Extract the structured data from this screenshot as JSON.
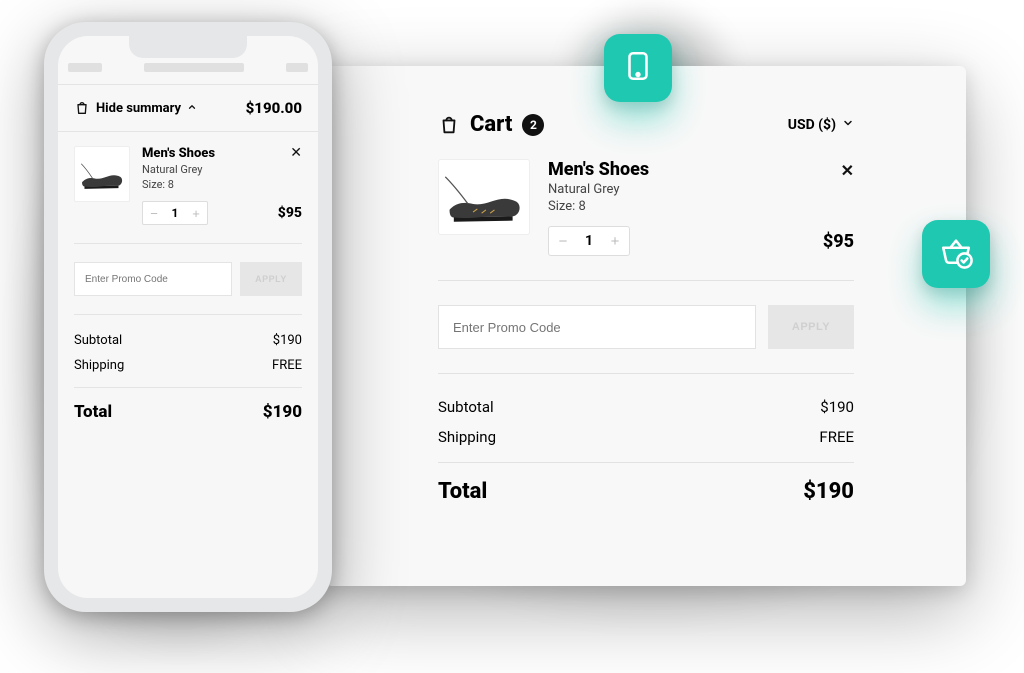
{
  "mobile": {
    "summary_toggle_label": "Hide summary",
    "summary_price": "$190.00",
    "item": {
      "title": "Men's Shoes",
      "color": "Natural Grey",
      "size_label": "Size: 8",
      "qty": "1",
      "price": "$95"
    },
    "promo_placeholder": "Enter Promo Code",
    "apply_label": "APPLY",
    "subtotal_label": "Subtotal",
    "subtotal_value": "$190",
    "shipping_label": "Shipping",
    "shipping_value": "FREE",
    "total_label": "Total",
    "total_value": "$190"
  },
  "desktop": {
    "cart_label": "Cart",
    "cart_count": "2",
    "currency_label": "USD ($)",
    "item": {
      "title": "Men's Shoes",
      "color": "Natural Grey",
      "size_label": "Size: 8",
      "qty": "1",
      "price": "$95"
    },
    "promo_placeholder": "Enter Promo Code",
    "apply_label": "APPLY",
    "subtotal_label": "Subtotal",
    "subtotal_value": "$190",
    "shipping_label": "Shipping",
    "shipping_value": "FREE",
    "total_label": "Total",
    "total_value": "$190"
  }
}
